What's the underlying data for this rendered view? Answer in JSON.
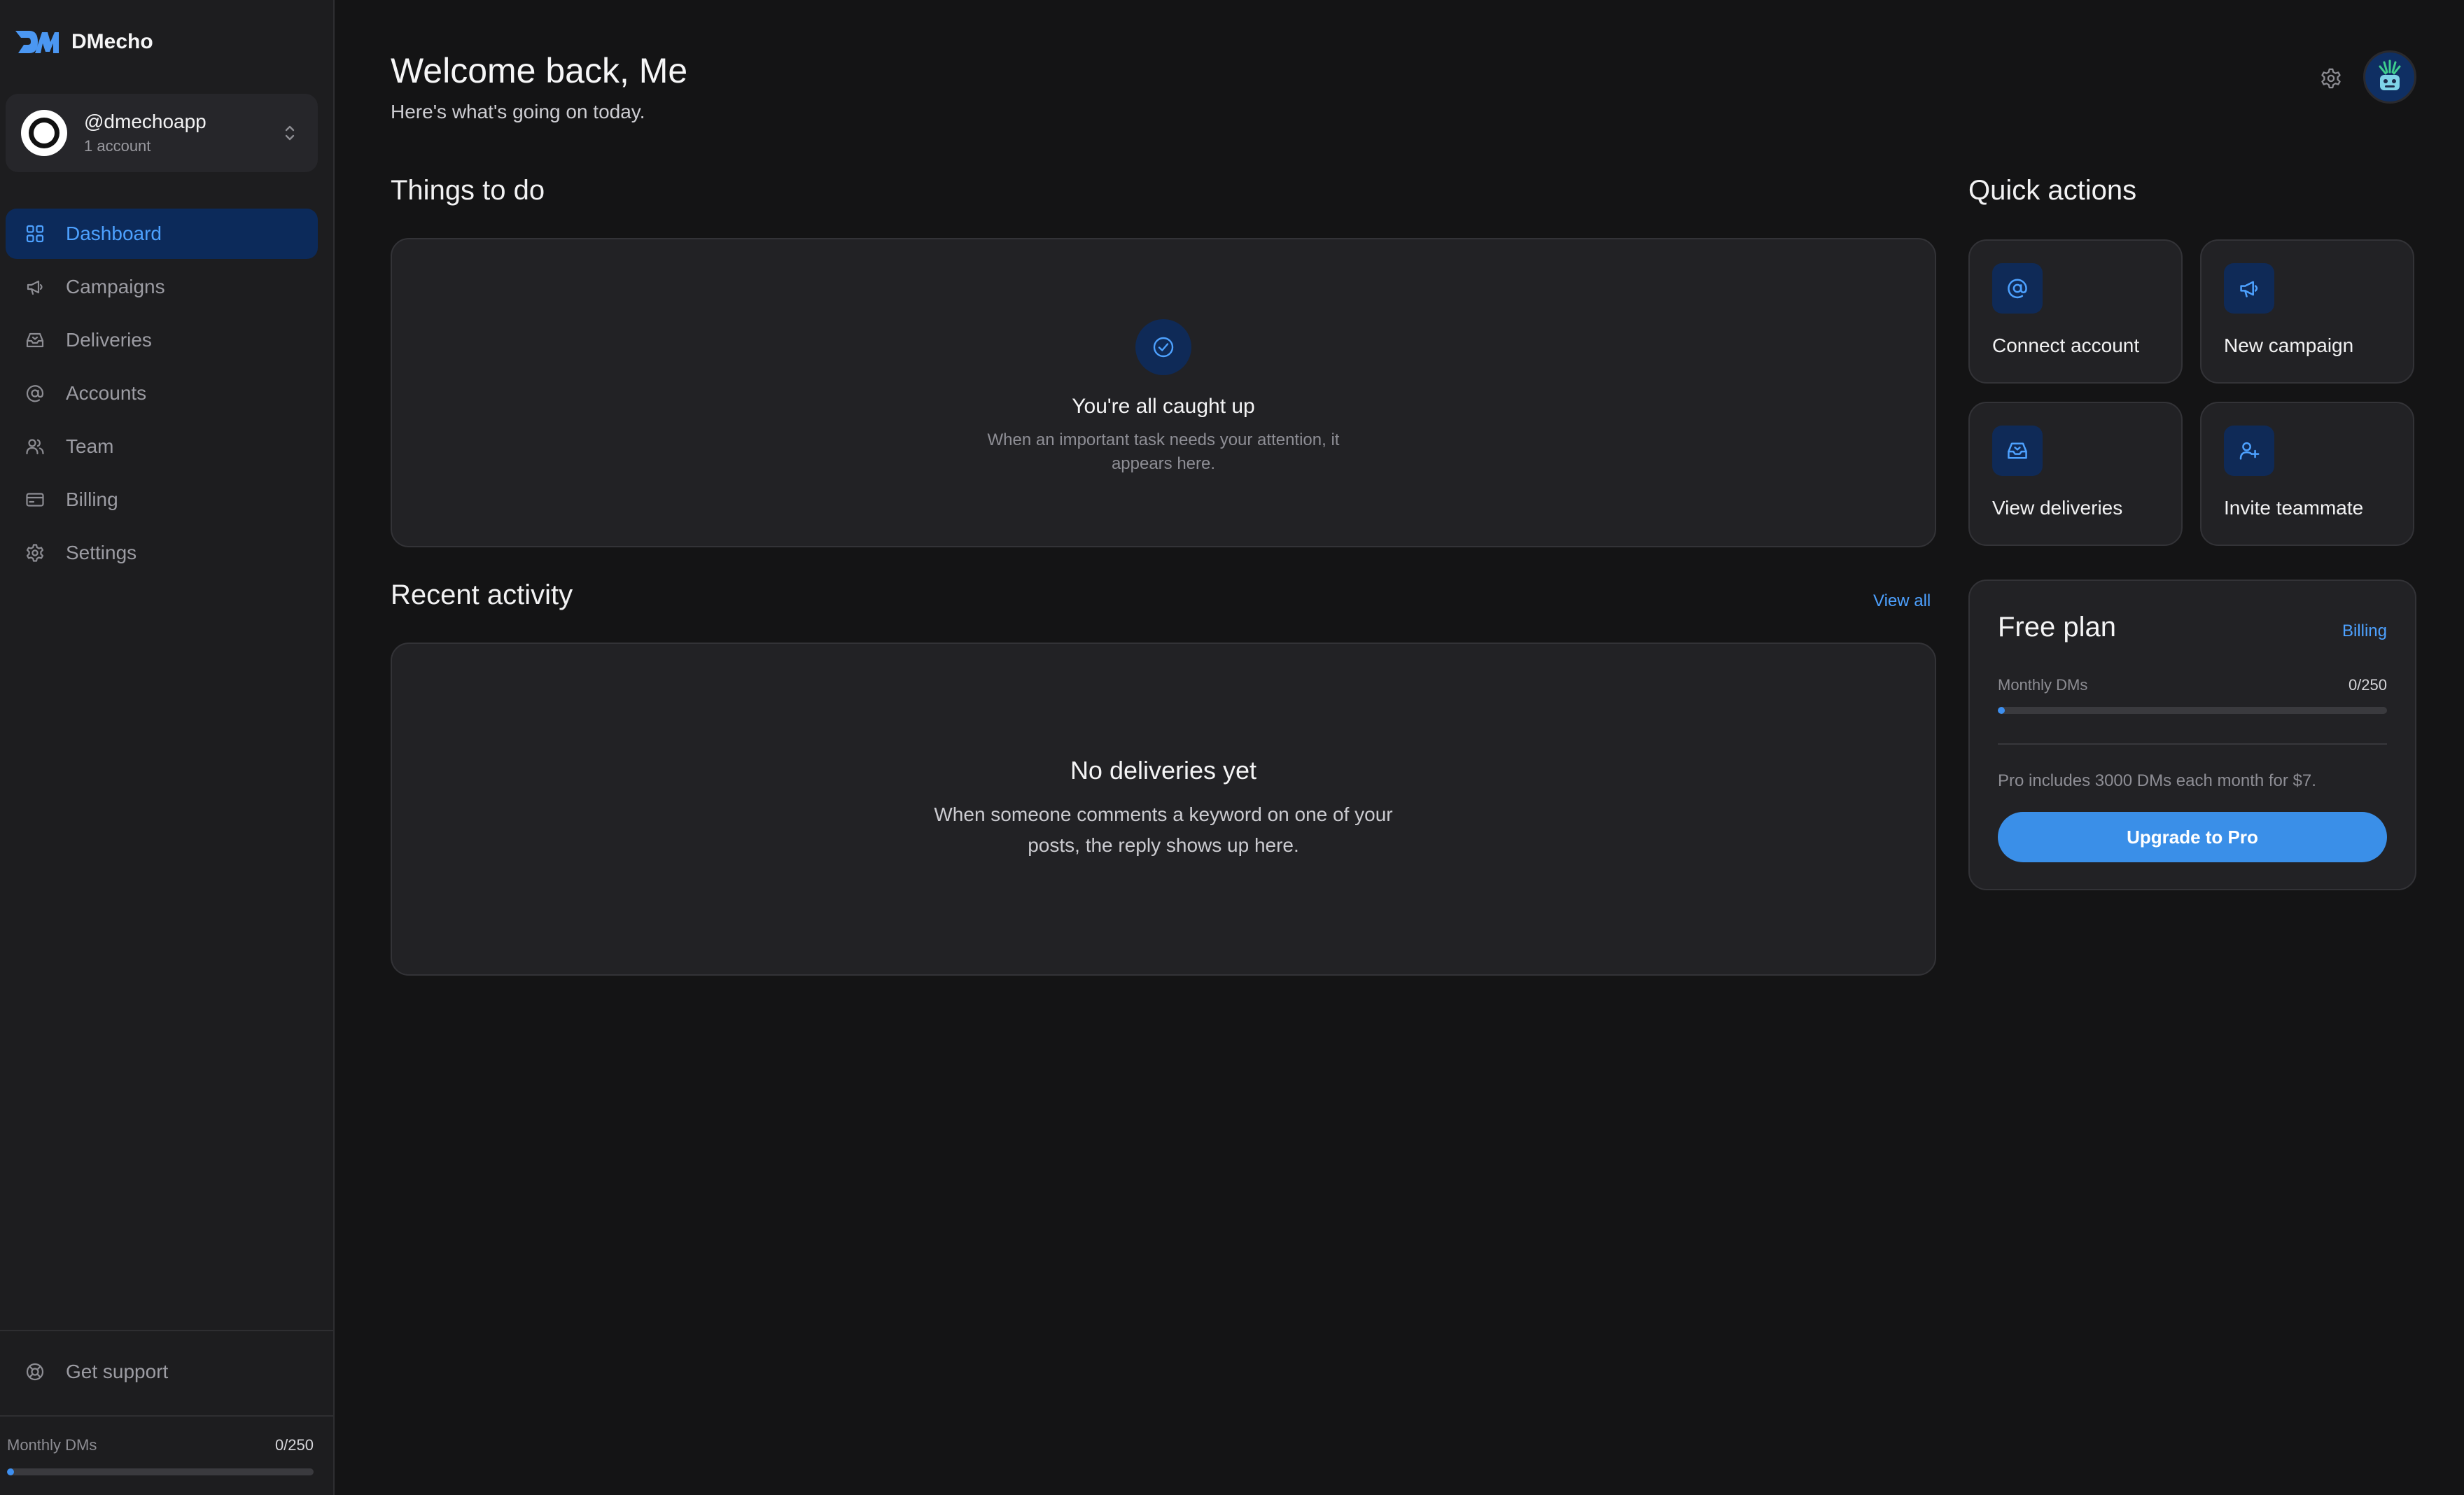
{
  "brand": {
    "name": "DMecho"
  },
  "account": {
    "handle": "@dmechoapp",
    "sub": "1 account"
  },
  "nav": {
    "items": [
      {
        "label": "Dashboard",
        "icon": "grid-icon",
        "active": true
      },
      {
        "label": "Campaigns",
        "icon": "megaphone-icon"
      },
      {
        "label": "Deliveries",
        "icon": "inbox-icon"
      },
      {
        "label": "Accounts",
        "icon": "at-sign-icon"
      },
      {
        "label": "Team",
        "icon": "users-icon"
      },
      {
        "label": "Billing",
        "icon": "credit-card-icon"
      },
      {
        "label": "Settings",
        "icon": "gear-icon"
      }
    ],
    "support_label": "Get support"
  },
  "sidebar_usage": {
    "label": "Monthly DMs",
    "value": "0/250",
    "fraction": 0.0
  },
  "header": {
    "title": "Welcome back, Me",
    "subtitle": "Here's what's going on today."
  },
  "todo": {
    "section_title": "Things to do",
    "empty_title": "You're all caught up",
    "empty_desc": "When an important task needs your attention, it appears here."
  },
  "activity": {
    "section_title": "Recent activity",
    "view_all": "View all",
    "empty_title": "No deliveries yet",
    "empty_desc": "When someone comments a keyword on one of your posts, the reply shows up here."
  },
  "quick_actions": {
    "section_title": "Quick actions",
    "items": [
      {
        "label": "Connect account",
        "icon": "at-sign-icon"
      },
      {
        "label": "New campaign",
        "icon": "megaphone-icon"
      },
      {
        "label": "View deliveries",
        "icon": "inbox-icon"
      },
      {
        "label": "Invite teammate",
        "icon": "user-plus-icon"
      }
    ]
  },
  "plan": {
    "title": "Free plan",
    "billing_link": "Billing",
    "usage_label": "Monthly DMs",
    "usage_value": "0/250",
    "usage_fraction": 0.0,
    "note": "Pro includes 3000 DMs each month for $7.",
    "upgrade_label": "Upgrade to Pro"
  },
  "colors": {
    "accent": "#3a8fe8",
    "accent_text": "#4da1ff",
    "active_bg": "#0c2a5a",
    "background": "#141415",
    "card": "#222225"
  }
}
